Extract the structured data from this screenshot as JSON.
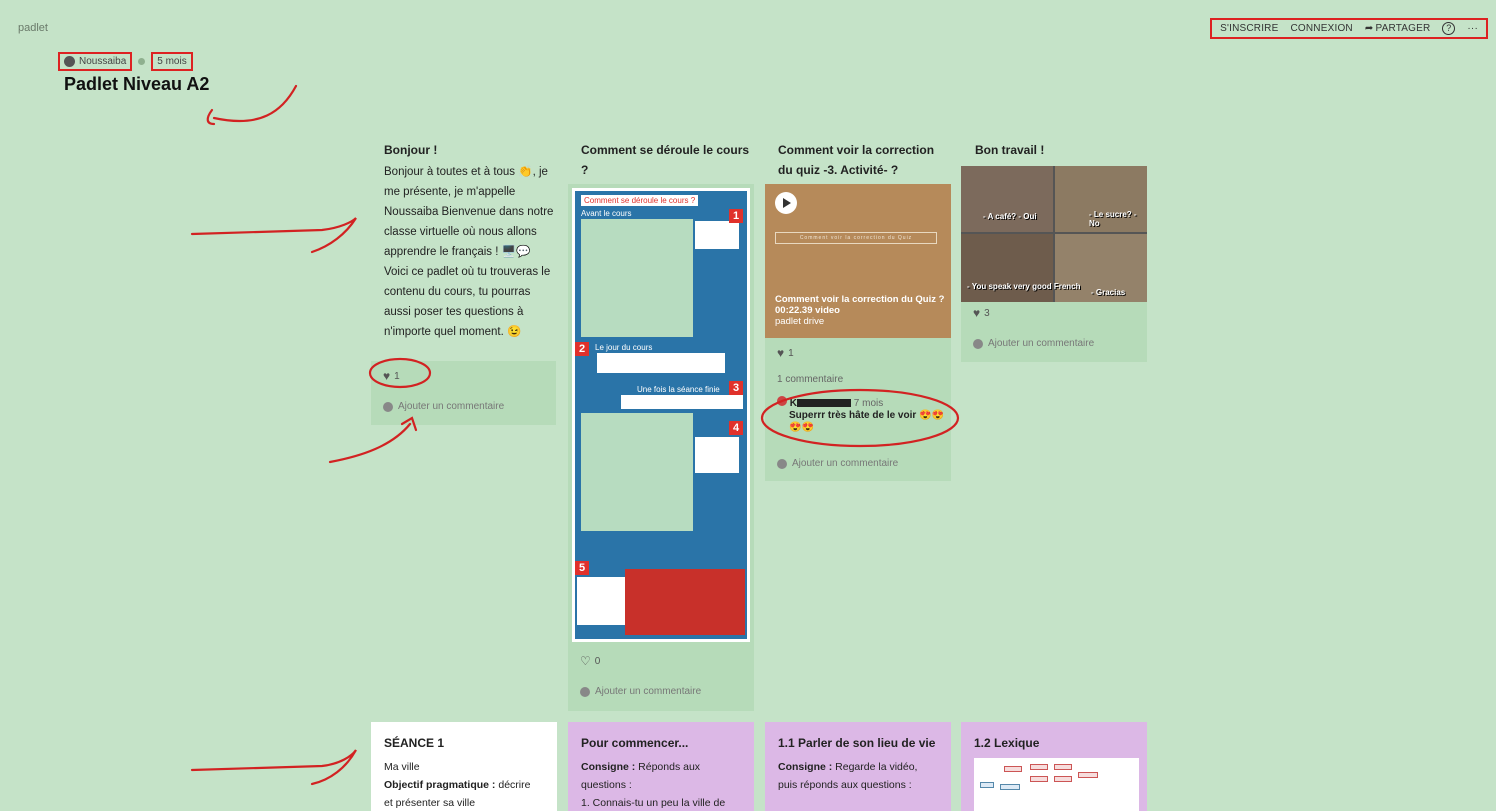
{
  "app": {
    "brand": "padlet"
  },
  "header": {
    "actions": {
      "signup": "S'INSCRIRE",
      "login": "CONNEXION",
      "share": "PARTAGER",
      "help": "?",
      "more": "···"
    },
    "author": "Noussaiba",
    "age": "5 mois",
    "title": "Padlet Niveau A2"
  },
  "columns": [
    {
      "title": "Bonjour !",
      "body": "Bonjour à toutes et à tous 👏, je me présente, je m'appelle Noussaiba Bienvenue dans notre classe virtuelle où nous allons apprendre le français ! 🖥️💬 Voici ce padlet où tu trouveras le contenu du cours, tu pourras aussi poser tes questions à n'importe quel moment. 😉",
      "likes": "1",
      "add_comment": "Ajouter un commentaire"
    },
    {
      "title": "Comment se déroule le cours ?",
      "image": {
        "heading": "Comment se déroule le cours ?",
        "sec1": "Avant le cours",
        "sec2": "Le jour du cours",
        "sec3": "Une fois la séance finie",
        "badges": [
          "1",
          "2",
          "3",
          "4",
          "5"
        ]
      },
      "likes": "0",
      "add_comment": "Ajouter un commentaire"
    },
    {
      "title": "Comment voir la correction du quiz -3. Activité- ?",
      "video": {
        "strip": "Comment voir la correction du Quiz",
        "name": "Comment voir la correction du Quiz ?",
        "duration": "00:22.39 video",
        "source": "padlet drive"
      },
      "likes": "1",
      "comment_count": "1 commentaire",
      "comment": {
        "author": "K",
        "age": "7 mois",
        "text": "Superrr très hâte de le voir 😍😍😍😍"
      },
      "add_comment": "Ajouter un commentaire"
    },
    {
      "title": "Bon travail !",
      "captions": [
        "- A café? - Oui",
        "- Le sucre? - No",
        "- You speak very good French",
        "- Gracias"
      ],
      "likes": "3",
      "add_comment": "Ajouter un commentaire"
    }
  ],
  "row2": [
    {
      "title": "SÉANCE 1",
      "line1": "Ma ville",
      "bold": "Objectif pragmatique :",
      "rest": " décrire",
      "line3": "et présenter sa ville"
    },
    {
      "title": "Pour commencer...",
      "bold": "Consigne :",
      "rest": " Réponds aux",
      "line2": "questions :",
      "line3": "1. Connais-tu un peu la ville de"
    },
    {
      "title": "1.1 Parler de son lieu de vie",
      "bold": "Consigne :",
      "rest": " Regarde la vidéo,",
      "line2": "puis réponds aux questions :"
    },
    {
      "title": "1.2 Lexique"
    }
  ],
  "colors": {
    "background": "#c5e3c8",
    "card": "#b6dbb9",
    "purple_card": "#dcb8e6",
    "annotation_red": "#d22222"
  }
}
